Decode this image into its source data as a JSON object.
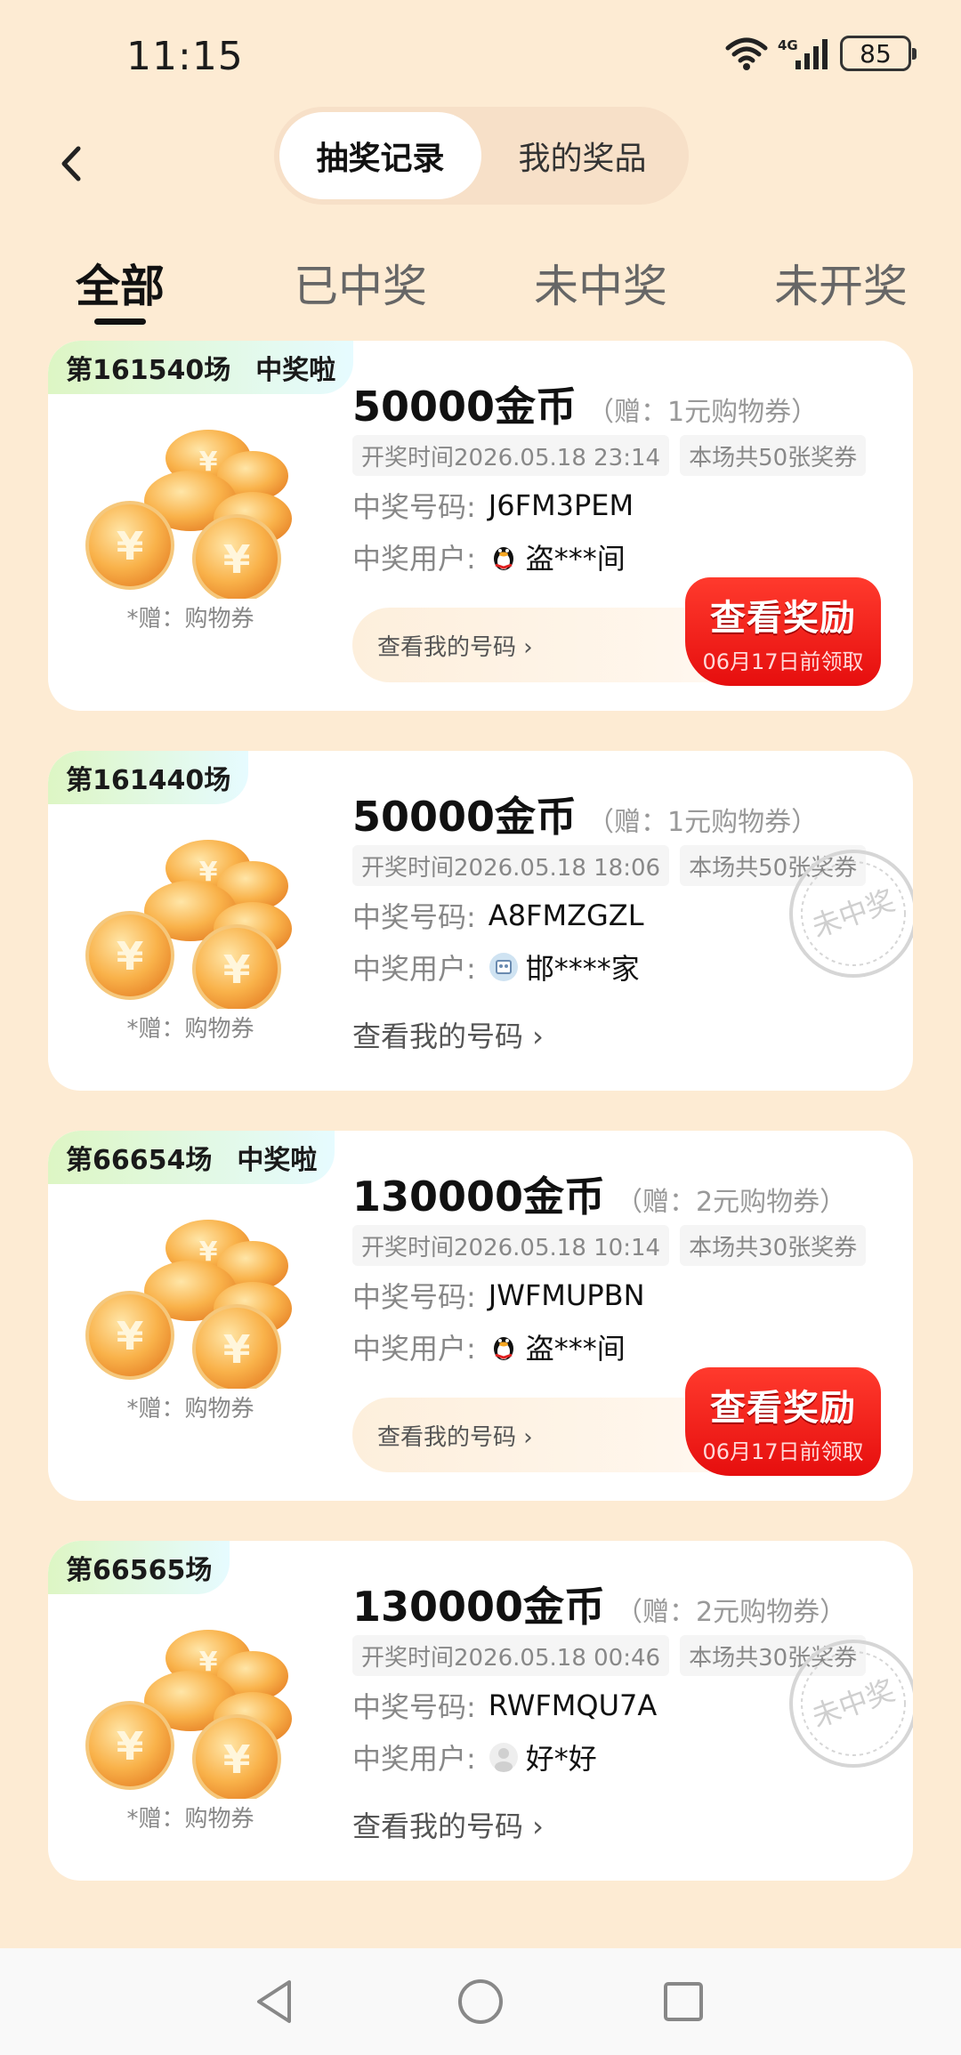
{
  "status_bar": {
    "time": "11:15",
    "network": "4G",
    "battery": "85"
  },
  "header": {
    "segments": [
      {
        "label": "抽奖记录",
        "active": true
      },
      {
        "label": "我的奖品",
        "active": false
      }
    ]
  },
  "tabs": [
    {
      "label": "全部",
      "active": true
    },
    {
      "label": "已中奖",
      "active": false
    },
    {
      "label": "未中奖",
      "active": false
    },
    {
      "label": "未开奖",
      "active": false
    }
  ],
  "cards": [
    {
      "round": "第161540场",
      "badge": "中奖啦",
      "prize_caption": "*赠：购物券",
      "amount": "50000金币",
      "gift": "（赠：1元购物券）",
      "draw_time": "开奖时间2026.05.18 23:14",
      "ticket_count": "本场共50张奖券",
      "winning_code_label": "中奖号码:",
      "winning_code": "J6FM3PEM",
      "winner_label": "中奖用户:",
      "winner_name": "盗***间",
      "winner_avatar": "penguin-icon",
      "my_code_label": "查看我的号码 ›",
      "reward_title": "查看奖励",
      "reward_deadline": "06月17日前领取",
      "stamp": ""
    },
    {
      "round": "第161440场",
      "badge": "",
      "prize_caption": "*赠：购物券",
      "amount": "50000金币",
      "gift": "（赠：1元购物券）",
      "draw_time": "开奖时间2026.05.18 18:06",
      "ticket_count": "本场共50张奖券",
      "winning_code_label": "中奖号码:",
      "winning_code": "A8FMZGZL",
      "winner_label": "中奖用户:",
      "winner_name": "邯****家",
      "winner_avatar": "avatar-icon",
      "my_code_label": "查看我的号码 ›",
      "reward_title": "",
      "reward_deadline": "",
      "stamp": "未中奖"
    },
    {
      "round": "第66654场",
      "badge": "中奖啦",
      "prize_caption": "*赠：购物券",
      "amount": "130000金币",
      "gift": "（赠：2元购物券）",
      "draw_time": "开奖时间2026.05.18 10:14",
      "ticket_count": "本场共30张奖券",
      "winning_code_label": "中奖号码:",
      "winning_code": "JWFMUPBN",
      "winner_label": "中奖用户:",
      "winner_name": "盗***间",
      "winner_avatar": "penguin-icon",
      "my_code_label": "查看我的号码 ›",
      "reward_title": "查看奖励",
      "reward_deadline": "06月17日前领取",
      "stamp": ""
    },
    {
      "round": "第66565场",
      "badge": "",
      "prize_caption": "*赠：购物券",
      "amount": "130000金币",
      "gift": "（赠：2元购物券）",
      "draw_time": "开奖时间2026.05.18 00:46",
      "ticket_count": "本场共30张奖券",
      "winning_code_label": "中奖号码:",
      "winning_code": "RWFMQU7A",
      "winner_label": "中奖用户:",
      "winner_name": "好*好",
      "winner_avatar": "default-avatar-icon",
      "my_code_label": "查看我的号码 ›",
      "reward_title": "",
      "reward_deadline": "",
      "stamp": "未中奖"
    }
  ],
  "colors": {
    "background": "#fdebd3",
    "reward_red": "#e60e0e",
    "tag_green": "#ddf6c4"
  },
  "system_nav": [
    "back-triangle-icon",
    "home-circle-icon",
    "recents-square-icon"
  ]
}
